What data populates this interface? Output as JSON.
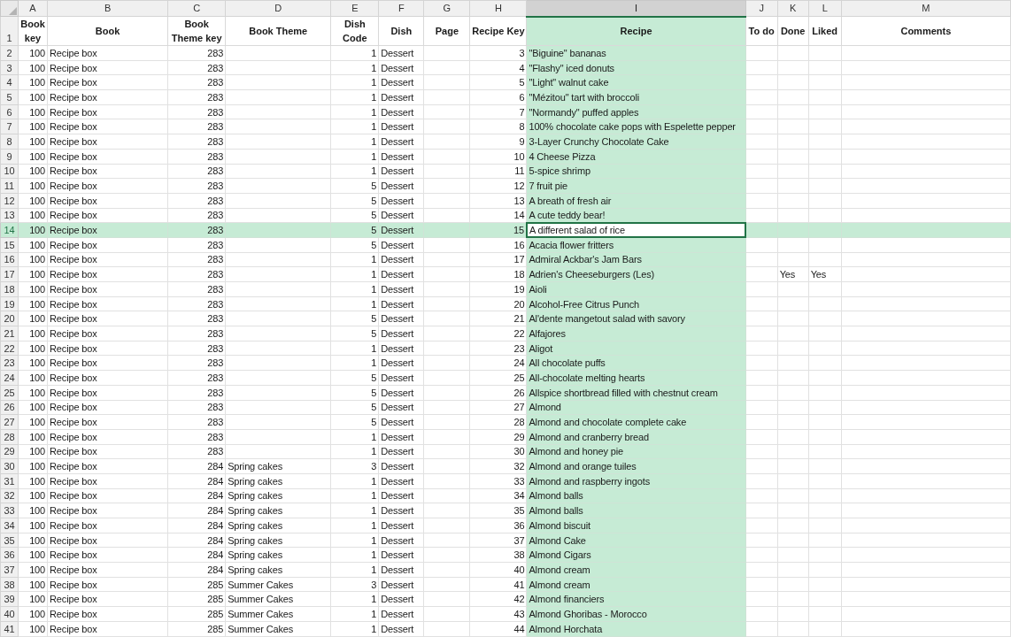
{
  "sheet": {
    "header_row": {
      "number": "1"
    },
    "columns": [
      {
        "letter": "A",
        "header": "Book key",
        "kind": "number",
        "selected": false
      },
      {
        "letter": "B",
        "header": "Book",
        "kind": "text",
        "selected": false
      },
      {
        "letter": "C",
        "header": "Book Theme key",
        "kind": "number",
        "selected": false
      },
      {
        "letter": "D",
        "header": "Book Theme",
        "kind": "text",
        "selected": false
      },
      {
        "letter": "E",
        "header": "Dish Code",
        "kind": "number",
        "selected": false
      },
      {
        "letter": "F",
        "header": "Dish",
        "kind": "text",
        "selected": false
      },
      {
        "letter": "G",
        "header": "Page",
        "kind": "number",
        "selected": false
      },
      {
        "letter": "H",
        "header": "Recipe Key",
        "kind": "number",
        "selected": false
      },
      {
        "letter": "I",
        "header": "Recipe",
        "kind": "text",
        "selected": true
      },
      {
        "letter": "J",
        "header": "To do",
        "kind": "text",
        "selected": false
      },
      {
        "letter": "K",
        "header": "Done",
        "kind": "text",
        "selected": false
      },
      {
        "letter": "L",
        "header": "Liked",
        "kind": "text",
        "selected": false
      },
      {
        "letter": "M",
        "header": "Comments",
        "kind": "text",
        "selected": false
      }
    ],
    "rows": [
      {
        "number": "2",
        "selected": false,
        "cells": {
          "A": "100",
          "B": "Recipe box",
          "C": "283",
          "E": "1",
          "F": "Dessert",
          "H": "3",
          "I": "\"Biguine\" bananas"
        }
      },
      {
        "number": "3",
        "selected": false,
        "cells": {
          "A": "100",
          "B": "Recipe box",
          "C": "283",
          "E": "1",
          "F": "Dessert",
          "H": "4",
          "I": "\"Flashy\" iced donuts"
        }
      },
      {
        "number": "4",
        "selected": false,
        "cells": {
          "A": "100",
          "B": "Recipe box",
          "C": "283",
          "E": "1",
          "F": "Dessert",
          "H": "5",
          "I": "\"Light\" walnut cake"
        }
      },
      {
        "number": "5",
        "selected": false,
        "cells": {
          "A": "100",
          "B": "Recipe box",
          "C": "283",
          "E": "1",
          "F": "Dessert",
          "H": "6",
          "I": "\"Mézitou\" tart with broccoli"
        }
      },
      {
        "number": "6",
        "selected": false,
        "cells": {
          "A": "100",
          "B": "Recipe box",
          "C": "283",
          "E": "1",
          "F": "Dessert",
          "H": "7",
          "I": "\"Normandy\" puffed apples"
        }
      },
      {
        "number": "7",
        "selected": false,
        "cells": {
          "A": "100",
          "B": "Recipe box",
          "C": "283",
          "E": "1",
          "F": "Dessert",
          "H": "8",
          "I": "100% chocolate cake pops with Espelette pepper"
        }
      },
      {
        "number": "8",
        "selected": false,
        "cells": {
          "A": "100",
          "B": "Recipe box",
          "C": "283",
          "E": "1",
          "F": "Dessert",
          "H": "9",
          "I": "3-Layer Crunchy Chocolate Cake"
        }
      },
      {
        "number": "9",
        "selected": false,
        "cells": {
          "A": "100",
          "B": "Recipe box",
          "C": "283",
          "E": "1",
          "F": "Dessert",
          "H": "10",
          "I": "4 Cheese Pizza"
        }
      },
      {
        "number": "10",
        "selected": false,
        "cells": {
          "A": "100",
          "B": "Recipe box",
          "C": "283",
          "E": "1",
          "F": "Dessert",
          "H": "11",
          "I": "5-spice shrimp"
        }
      },
      {
        "number": "11",
        "selected": false,
        "cells": {
          "A": "100",
          "B": "Recipe box",
          "C": "283",
          "E": "5",
          "F": "Dessert",
          "H": "12",
          "I": "7 fruit pie"
        }
      },
      {
        "number": "12",
        "selected": false,
        "cells": {
          "A": "100",
          "B": "Recipe box",
          "C": "283",
          "E": "5",
          "F": "Dessert",
          "H": "13",
          "I": "A breath of fresh air"
        }
      },
      {
        "number": "13",
        "selected": false,
        "cells": {
          "A": "100",
          "B": "Recipe box",
          "C": "283",
          "E": "5",
          "F": "Dessert",
          "H": "14",
          "I": "A cute teddy bear!"
        }
      },
      {
        "number": "14",
        "selected": true,
        "cells": {
          "A": "100",
          "B": "Recipe box",
          "C": "283",
          "E": "5",
          "F": "Dessert",
          "H": "15",
          "I": "A different salad of rice"
        }
      },
      {
        "number": "15",
        "selected": false,
        "cells": {
          "A": "100",
          "B": "Recipe box",
          "C": "283",
          "E": "5",
          "F": "Dessert",
          "H": "16",
          "I": "Acacia flower fritters"
        }
      },
      {
        "number": "16",
        "selected": false,
        "cells": {
          "A": "100",
          "B": "Recipe box",
          "C": "283",
          "E": "1",
          "F": "Dessert",
          "H": "17",
          "I": "Admiral Ackbar's Jam Bars"
        }
      },
      {
        "number": "17",
        "selected": false,
        "cells": {
          "A": "100",
          "B": "Recipe box",
          "C": "283",
          "E": "1",
          "F": "Dessert",
          "H": "18",
          "I": "Adrien's Cheeseburgers (Les)",
          "K": "Yes",
          "L": "Yes"
        }
      },
      {
        "number": "18",
        "selected": false,
        "cells": {
          "A": "100",
          "B": "Recipe box",
          "C": "283",
          "E": "1",
          "F": "Dessert",
          "H": "19",
          "I": "Aioli"
        }
      },
      {
        "number": "19",
        "selected": false,
        "cells": {
          "A": "100",
          "B": "Recipe box",
          "C": "283",
          "E": "1",
          "F": "Dessert",
          "H": "20",
          "I": "Alcohol-Free Citrus Punch"
        }
      },
      {
        "number": "20",
        "selected": false,
        "cells": {
          "A": "100",
          "B": "Recipe box",
          "C": "283",
          "E": "5",
          "F": "Dessert",
          "H": "21",
          "I": "Al'dente mangetout salad with savory"
        }
      },
      {
        "number": "21",
        "selected": false,
        "cells": {
          "A": "100",
          "B": "Recipe box",
          "C": "283",
          "E": "5",
          "F": "Dessert",
          "H": "22",
          "I": "Alfajores"
        }
      },
      {
        "number": "22",
        "selected": false,
        "cells": {
          "A": "100",
          "B": "Recipe box",
          "C": "283",
          "E": "1",
          "F": "Dessert",
          "H": "23",
          "I": "Aligot"
        }
      },
      {
        "number": "23",
        "selected": false,
        "cells": {
          "A": "100",
          "B": "Recipe box",
          "C": "283",
          "E": "1",
          "F": "Dessert",
          "H": "24",
          "I": "All chocolate puffs"
        }
      },
      {
        "number": "24",
        "selected": false,
        "cells": {
          "A": "100",
          "B": "Recipe box",
          "C": "283",
          "E": "5",
          "F": "Dessert",
          "H": "25",
          "I": "All-chocolate melting hearts"
        }
      },
      {
        "number": "25",
        "selected": false,
        "cells": {
          "A": "100",
          "B": "Recipe box",
          "C": "283",
          "E": "5",
          "F": "Dessert",
          "H": "26",
          "I": "Allspice shortbread filled with chestnut cream"
        }
      },
      {
        "number": "26",
        "selected": false,
        "cells": {
          "A": "100",
          "B": "Recipe box",
          "C": "283",
          "E": "5",
          "F": "Dessert",
          "H": "27",
          "I": "Almond"
        }
      },
      {
        "number": "27",
        "selected": false,
        "cells": {
          "A": "100",
          "B": "Recipe box",
          "C": "283",
          "E": "5",
          "F": "Dessert",
          "H": "28",
          "I": "Almond and chocolate complete cake"
        }
      },
      {
        "number": "28",
        "selected": false,
        "cells": {
          "A": "100",
          "B": "Recipe box",
          "C": "283",
          "E": "1",
          "F": "Dessert",
          "H": "29",
          "I": "Almond and cranberry bread"
        }
      },
      {
        "number": "29",
        "selected": false,
        "cells": {
          "A": "100",
          "B": "Recipe box",
          "C": "283",
          "E": "1",
          "F": "Dessert",
          "H": "30",
          "I": "Almond and honey pie"
        }
      },
      {
        "number": "30",
        "selected": false,
        "cells": {
          "A": "100",
          "B": "Recipe box",
          "C": "284",
          "D": "Spring cakes",
          "E": "3",
          "F": "Dessert",
          "H": "32",
          "I": "Almond and orange tuiles"
        }
      },
      {
        "number": "31",
        "selected": false,
        "cells": {
          "A": "100",
          "B": "Recipe box",
          "C": "284",
          "D": "Spring cakes",
          "E": "1",
          "F": "Dessert",
          "H": "33",
          "I": "Almond and raspberry ingots"
        }
      },
      {
        "number": "32",
        "selected": false,
        "cells": {
          "A": "100",
          "B": "Recipe box",
          "C": "284",
          "D": "Spring cakes",
          "E": "1",
          "F": "Dessert",
          "H": "34",
          "I": "Almond balls"
        }
      },
      {
        "number": "33",
        "selected": false,
        "cells": {
          "A": "100",
          "B": "Recipe box",
          "C": "284",
          "D": "Spring cakes",
          "E": "1",
          "F": "Dessert",
          "H": "35",
          "I": "Almond balls"
        }
      },
      {
        "number": "34",
        "selected": false,
        "cells": {
          "A": "100",
          "B": "Recipe box",
          "C": "284",
          "D": "Spring cakes",
          "E": "1",
          "F": "Dessert",
          "H": "36",
          "I": "Almond biscuit"
        }
      },
      {
        "number": "35",
        "selected": false,
        "cells": {
          "A": "100",
          "B": "Recipe box",
          "C": "284",
          "D": "Spring cakes",
          "E": "1",
          "F": "Dessert",
          "H": "37",
          "I": "Almond Cake"
        }
      },
      {
        "number": "36",
        "selected": false,
        "cells": {
          "A": "100",
          "B": "Recipe box",
          "C": "284",
          "D": "Spring cakes",
          "E": "1",
          "F": "Dessert",
          "H": "38",
          "I": "Almond Cigars"
        }
      },
      {
        "number": "37",
        "selected": false,
        "cells": {
          "A": "100",
          "B": "Recipe box",
          "C": "284",
          "D": "Spring cakes",
          "E": "1",
          "F": "Dessert",
          "H": "40",
          "I": "Almond cream"
        }
      },
      {
        "number": "38",
        "selected": false,
        "cells": {
          "A": "100",
          "B": "Recipe box",
          "C": "285",
          "D": "Summer Cakes",
          "E": "3",
          "F": "Dessert",
          "H": "41",
          "I": "Almond cream"
        }
      },
      {
        "number": "39",
        "selected": false,
        "cells": {
          "A": "100",
          "B": "Recipe box",
          "C": "285",
          "D": "Summer Cakes",
          "E": "1",
          "F": "Dessert",
          "H": "42",
          "I": "Almond financiers"
        }
      },
      {
        "number": "40",
        "selected": false,
        "cells": {
          "A": "100",
          "B": "Recipe box",
          "C": "285",
          "D": "Summer Cakes",
          "E": "1",
          "F": "Dessert",
          "H": "43",
          "I": "Almond Ghoribas - Morocco"
        }
      },
      {
        "number": "41",
        "selected": false,
        "cells": {
          "A": "100",
          "B": "Recipe box",
          "C": "285",
          "D": "Summer Cakes",
          "E": "1",
          "F": "Dessert",
          "H": "44",
          "I": "Almond Horchata"
        }
      }
    ]
  }
}
